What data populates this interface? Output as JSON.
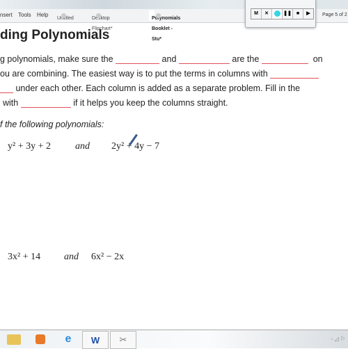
{
  "menu": {
    "items": [
      "nsert",
      "Tools",
      "Help"
    ]
  },
  "tabs": [
    {
      "label": "Untitled"
    },
    {
      "label": "Desktop Flipchart*"
    },
    {
      "label": "Polynomials Booklet -Stu*",
      "active": true
    }
  ],
  "recorder": {
    "buttons": [
      "M",
      "✕",
      "●",
      "❚❚",
      "■",
      "▶"
    ],
    "record_color": "#33d6e6"
  },
  "page_indicator": "Page 5 of 2",
  "document": {
    "title": "ding Polynomials",
    "line1": [
      "g polynomials, make sure the ",
      "and ",
      "are the ",
      "on"
    ],
    "line2": "ou are combining.  The easiest way is to put the terms in columns with ",
    "line3": " under each other.  Each column is added as a separate problem.  Fill in the",
    "line4": [
      "with ",
      "if it helps you keep the columns straight."
    ],
    "instruction": "f the following polynomials:",
    "problem1": {
      "a": "y² + 3y + 2",
      "and": "and",
      "b": "2y² + 4y − 7"
    },
    "problem2": {
      "a": "3x² + 14",
      "and": "and",
      "b": "6x² − 2x"
    }
  },
  "taskbar": {
    "icons": [
      "folder-icon",
      "media-player-icon",
      "internet-explorer-icon",
      "word-icon",
      "snipping-tool-icon"
    ]
  },
  "blank_color": "#e0505a"
}
